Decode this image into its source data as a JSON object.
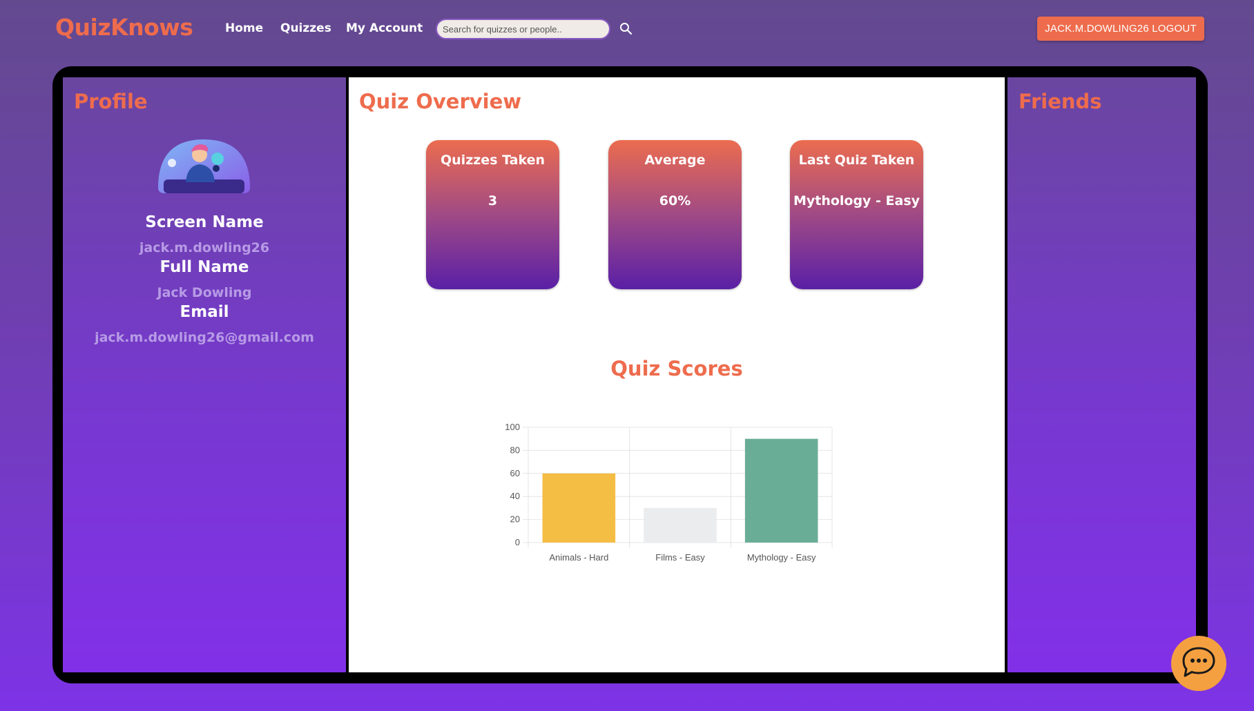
{
  "header": {
    "brand": "QuizKnows",
    "nav": [
      "Home",
      "Quizzes",
      "My Account"
    ],
    "search_placeholder": "Search for quizzes or people..",
    "logout_label": "JACK.M.DOWLING26 LOGOUT"
  },
  "profile": {
    "title": "Profile",
    "screen_name_label": "Screen Name",
    "screen_name": "jack.m.dowling26",
    "full_name_label": "Full Name",
    "full_name": "Jack Dowling",
    "email_label": "Email",
    "email": "jack.m.dowling26@gmail.com"
  },
  "overview": {
    "title": "Quiz Overview",
    "cards": [
      {
        "title": "Quizzes Taken",
        "value": "3"
      },
      {
        "title": "Average",
        "value": "60%"
      },
      {
        "title": "Last Quiz Taken",
        "value": "Mythology - Easy"
      }
    ],
    "chart_title": "Quiz Scores"
  },
  "friends": {
    "title": "Friends"
  },
  "icons": {
    "search": "search-icon",
    "chat": "chat-bubble-icon",
    "avatar": "avatar-illustration"
  },
  "colors": {
    "accent": "#ee6c4d",
    "chat": "#f5a040"
  },
  "chart_data": {
    "type": "bar",
    "categories": [
      "Animals - Hard",
      "Films - Easy",
      "Mythology - Easy"
    ],
    "values": [
      60,
      30,
      90
    ],
    "colors": [
      "#f4bd44",
      "#ebeced",
      "#6aad96"
    ],
    "ylim": [
      0,
      100
    ],
    "yticks": [
      0,
      20,
      40,
      60,
      80,
      100
    ],
    "grid": true,
    "title": "",
    "xlabel": "",
    "ylabel": ""
  }
}
